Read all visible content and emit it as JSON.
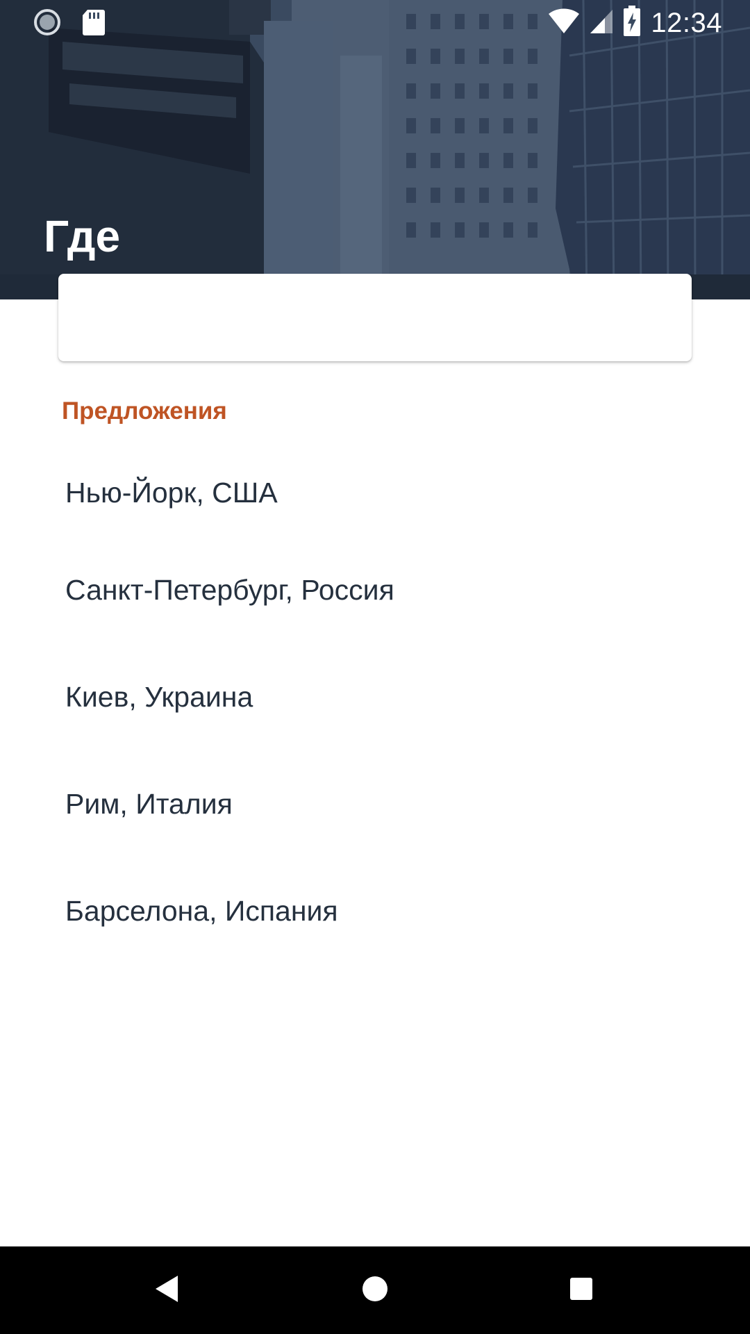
{
  "status_bar": {
    "time": "12:34",
    "icons": [
      "sync-icon",
      "sd-card-icon",
      "wifi-icon",
      "signal-icon",
      "battery-charging-icon"
    ]
  },
  "header": {
    "title": "Где",
    "background": "city-street-photo"
  },
  "search": {
    "value": "",
    "placeholder": ""
  },
  "suggestions": {
    "header": "Предложения",
    "items": [
      "Нью-Йорк, США",
      "Санкт-Петербург, Россия",
      "Киев, Украина",
      "Рим, Италия",
      "Барселона, Испания"
    ]
  },
  "nav_bar": {
    "buttons": [
      "back-icon",
      "home-icon",
      "recents-icon"
    ]
  },
  "colors": {
    "accent": "#bf5424",
    "text_primary": "#25303e",
    "hero_dark": "#233043",
    "nav_background": "#000000"
  }
}
